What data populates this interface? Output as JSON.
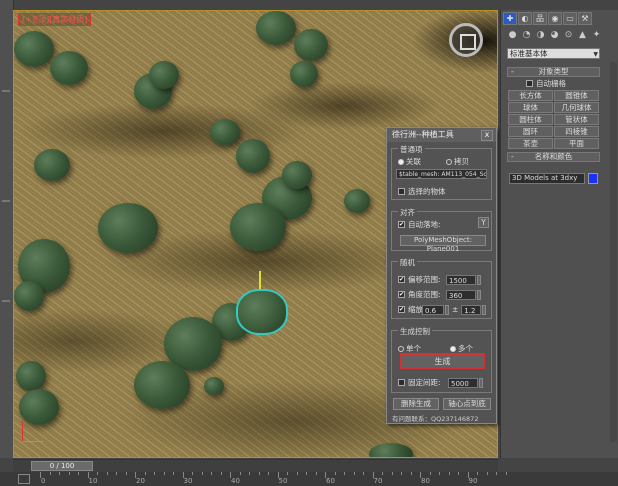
{
  "viewport": {
    "label": "[+][顶][真实材质]"
  },
  "tool_panel": {
    "title": "徐行洲--种植工具",
    "close": "x",
    "group1": {
      "label": "普通项",
      "radio_off": "关联",
      "radio_copy": "拷贝",
      "mesh_value": "$table_mesh: AM113_054_Sorbu",
      "select_objects": "选择的物体"
    },
    "group2": {
      "label": "对齐",
      "auto_ground": "自动落地:",
      "y_button": "Y",
      "object_button": "PolyMeshObject: Plane001"
    },
    "group3": {
      "label": "随机",
      "offset_label": "偏移范围:",
      "offset_value": "1500",
      "angle_label": "角度范围:",
      "angle_value": "360",
      "scale_label": "缩放",
      "scale_min": "0.6",
      "scale_sep": "±",
      "scale_max": "1.2"
    },
    "group4": {
      "label": "生成控制",
      "single": "单个",
      "multiple": "多个",
      "generate": "生成",
      "fixed_spacing": "固定间距:",
      "spacing_value": "5000"
    },
    "delete_button": "删除生成",
    "pivot_button": "轴心点到底",
    "contact": "有问题联系：QQ237146872"
  },
  "command_panel": {
    "tabs": [
      "✚",
      "◐",
      "品",
      "◉",
      "▭",
      "⚒"
    ],
    "icons": [
      "●",
      "◔",
      "◑",
      "◕",
      "⊙",
      "▲",
      "✦",
      "≋"
    ],
    "category": "标准基本体",
    "object_type": {
      "header": "对象类型",
      "sign": "-",
      "auto_grid": "自动栅格",
      "buttons": [
        "长方体",
        "圆锥体",
        "球体",
        "几何球体",
        "圆柱体",
        "管状体",
        "圆环",
        "四棱锥",
        "茶壶",
        "平面"
      ]
    },
    "name_color": {
      "header": "名称和颜色",
      "sign": "-",
      "name": "3D Models at 3dxy",
      "swatch_color": "#1b32ff"
    }
  },
  "timeline": {
    "frame": "0 / 100",
    "ticks": [
      "0",
      "10",
      "20",
      "30",
      "40",
      "50",
      "60",
      "70",
      "80",
      "90"
    ]
  }
}
